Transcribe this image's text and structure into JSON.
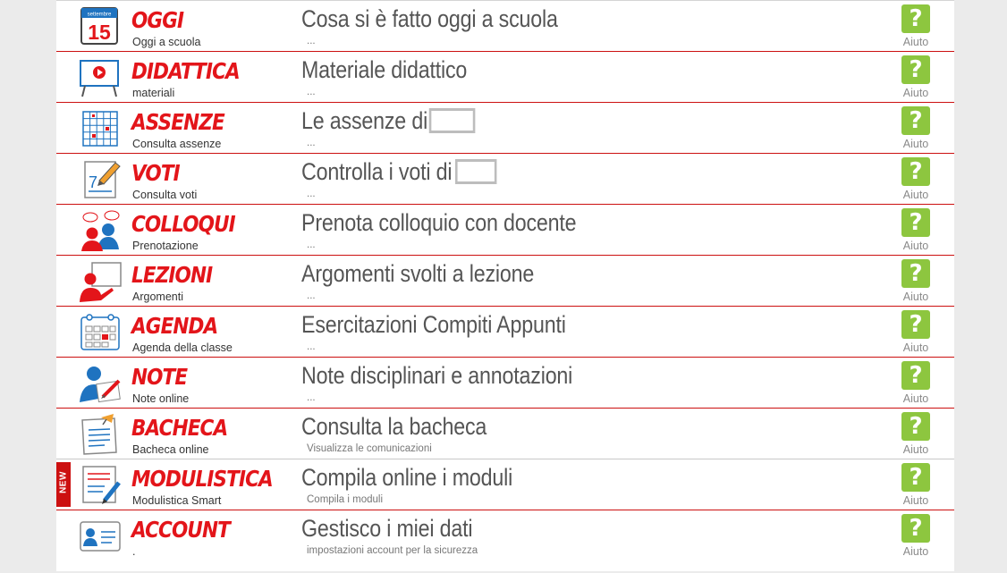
{
  "menu": [
    {
      "title": "OGGI",
      "subtitle": "Oggi a scuola",
      "heading": "Cosa si è fatto oggi a scuola",
      "desc": "...",
      "help": "Aiuto",
      "icon": "calendar-icon",
      "calendar_month": "settembre",
      "calendar_day": "15"
    },
    {
      "title": "DIDATTICA",
      "subtitle": "materiali",
      "heading": "Materiale didattico",
      "desc": "...",
      "help": "Aiuto",
      "icon": "presentation-board-icon"
    },
    {
      "title": "ASSENZE",
      "subtitle": "Consulta assenze",
      "heading": "Le assenze di",
      "desc": "...",
      "help": "Aiuto",
      "icon": "attendance-grid-icon"
    },
    {
      "title": "VOTI",
      "subtitle": "Consulta voti",
      "heading": "Controlla i voti di",
      "desc": "...",
      "help": "Aiuto",
      "icon": "grade-pencil-icon",
      "grade_digit": "7"
    },
    {
      "title": "COLLOQUI",
      "subtitle": "Prenotazione",
      "heading": "Prenota colloquio con docente",
      "desc": "...",
      "help": "Aiuto",
      "icon": "meeting-people-icon"
    },
    {
      "title": "LEZIONI",
      "subtitle": "Argomenti",
      "heading": "Argomenti svolti a lezione",
      "desc": "...",
      "help": "Aiuto",
      "icon": "teacher-board-icon"
    },
    {
      "title": "AGENDA",
      "subtitle": "Agenda della classe",
      "heading": "Esercitazioni Compiti Appunti",
      "desc": "...",
      "help": "Aiuto",
      "icon": "agenda-calendar-icon"
    },
    {
      "title": "NOTE",
      "subtitle": "Note online",
      "heading": "Note disciplinari e annotazioni",
      "desc": "...",
      "help": "Aiuto",
      "icon": "student-note-icon"
    },
    {
      "title": "BACHECA",
      "subtitle": "Bacheca online",
      "heading": "Consulta la bacheca",
      "desc": "Visualizza le comunicazioni",
      "help": "Aiuto",
      "icon": "notice-board-icon"
    },
    {
      "title": "MODULISTICA",
      "subtitle": "Modulistica Smart",
      "heading": "Compila online i moduli",
      "desc": "Compila i moduli",
      "help": "Aiuto",
      "icon": "form-pen-icon",
      "badge": "NEW"
    },
    {
      "title": "ACCOUNT",
      "subtitle": ".",
      "heading": "Gestisco i miei dati",
      "desc": "impostazioni account per la sicurezza",
      "help": "Aiuto",
      "icon": "id-card-icon"
    }
  ],
  "help_symbol": "?",
  "colors": {
    "title_red": "#e3151a",
    "help_green": "#8dc63f",
    "divider_red": "#cc1010",
    "icon_blue": "#1f73c0"
  }
}
